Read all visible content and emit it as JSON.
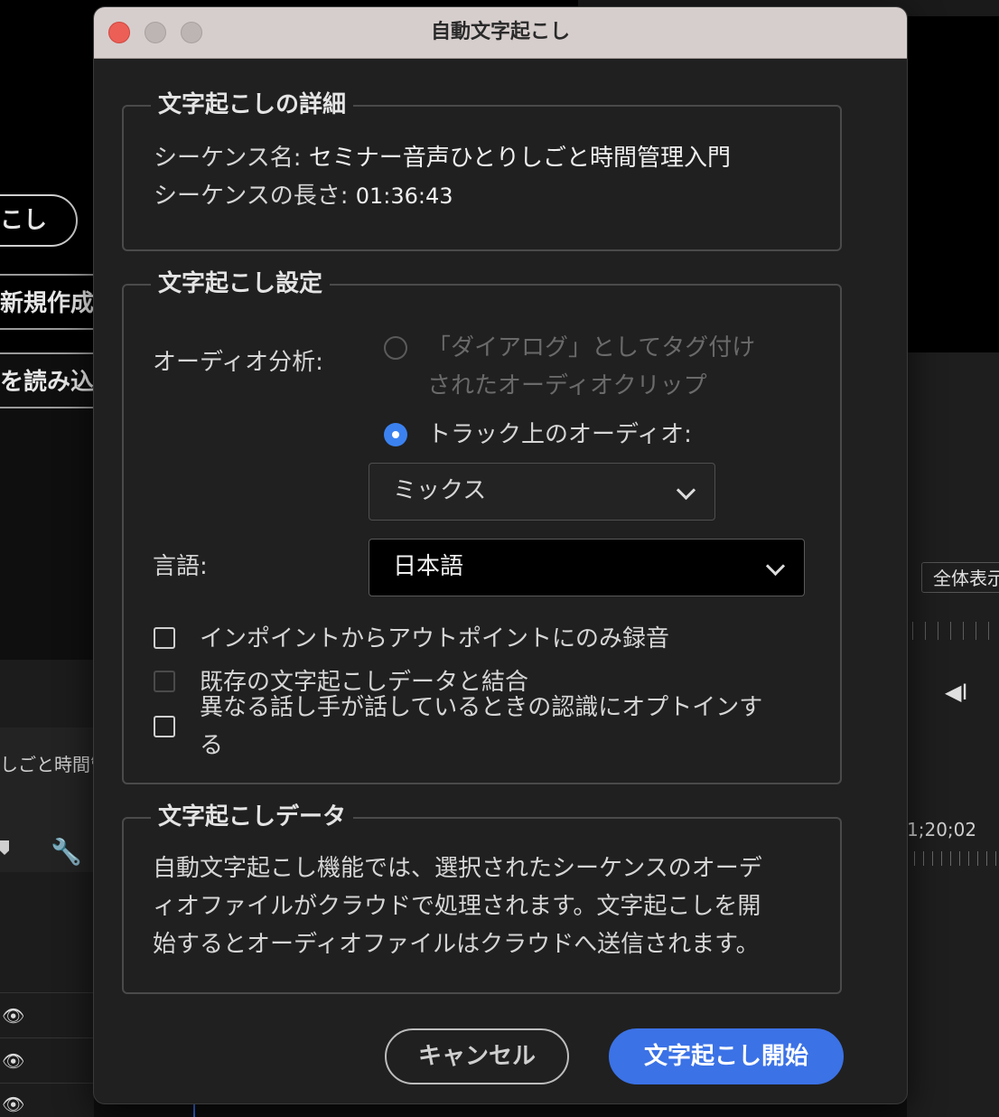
{
  "background": {
    "pill_label": "こし",
    "items": [
      "新規作成",
      "を読み込む"
    ],
    "sequence_label": "しごと時間管理",
    "zoom_label": "全体表示",
    "timecode": "1;20;02"
  },
  "dialog": {
    "title": "自動文字起こし",
    "details": {
      "legend": "文字起こしの詳細",
      "sequence_name_label": "シーケンス名:",
      "sequence_name": "セミナー音声ひとりしごと時間管理入門",
      "sequence_length_label": "シーケンスの長さ:",
      "sequence_length": "01:36:43"
    },
    "settings": {
      "legend": "文字起こし設定",
      "audio_analysis_label": "オーディオ分析:",
      "radio_dialog_line1": "「ダイアログ」としてタグ付け",
      "radio_dialog_line2": "されたオーディオクリップ",
      "radio_track": "トラック上のオーディオ:",
      "track_select": "ミックス",
      "language_label": "言語:",
      "language_select": "日本語",
      "checkbox_inout": "インポイントからアウトポイントにのみ録音",
      "checkbox_merge": "既存の文字起こしデータと結合",
      "checkbox_speaker_line1": "異なる話し手が話しているときの認識にオプトインす",
      "checkbox_speaker_line2": "る"
    },
    "data_section": {
      "legend": "文字起こしデータ",
      "line1": "自動文字起こし機能では、選択されたシーケンスのオーデ",
      "line2": "ィオファイルがクラウドで処理されます。文字起こしを開",
      "line3": "始するとオーディオファイルはクラウドへ送信されます。"
    },
    "buttons": {
      "cancel": "キャンセル",
      "start": "文字起こし開始"
    }
  },
  "colors": {
    "accent": "#3b72e6",
    "close": "#ec5f57",
    "dialog_bg": "#202020",
    "titlebar_bg": "#d6cecd"
  }
}
